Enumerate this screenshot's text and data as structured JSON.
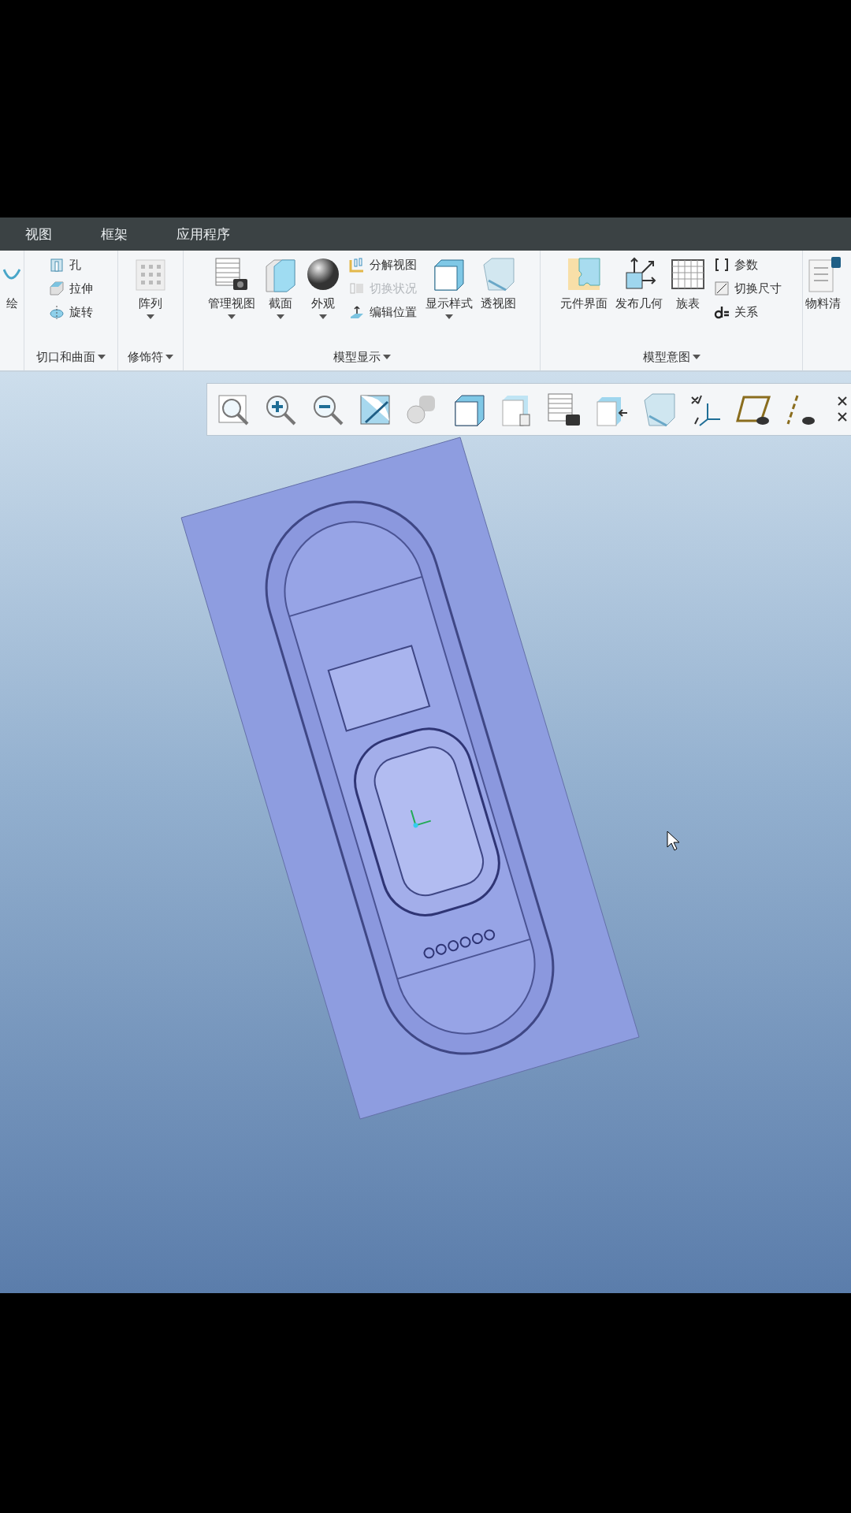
{
  "menu_tabs": [
    {
      "label": "视图"
    },
    {
      "label": "框架"
    },
    {
      "label": "应用程序"
    }
  ],
  "ribbon_groups": [
    {
      "items": [
        {
          "kind": "large",
          "label": "绘",
          "dropdown": false
        }
      ]
    },
    {
      "label": "切口和曲面",
      "items": [
        {
          "kind": "stack",
          "entries": [
            {
              "label": "孔",
              "disabled": false
            },
            {
              "label": "拉伸",
              "disabled": false
            },
            {
              "label": "旋转",
              "disabled": false
            }
          ]
        }
      ]
    },
    {
      "label": "修饰符",
      "items": [
        {
          "kind": "large",
          "label": "阵列",
          "dropdown": true
        }
      ]
    },
    {
      "label": "模型显示",
      "items": [
        {
          "kind": "large",
          "label": "管理视图",
          "dropdown": true
        },
        {
          "kind": "large",
          "label": "截面",
          "dropdown": true
        },
        {
          "kind": "large",
          "label": "外观",
          "dropdown": true
        },
        {
          "kind": "stack",
          "entries": [
            {
              "label": "分解视图",
              "disabled": false
            },
            {
              "label": "切换状况",
              "disabled": true
            },
            {
              "label": "编辑位置",
              "disabled": false
            }
          ]
        },
        {
          "kind": "large",
          "label": "显示样式",
          "dropdown": true
        },
        {
          "kind": "large",
          "label": "透视图",
          "dropdown": false
        }
      ]
    },
    {
      "label": "模型意图",
      "items": [
        {
          "kind": "large",
          "label": "元件界面",
          "dropdown": false
        },
        {
          "kind": "large",
          "label": "发布几何",
          "dropdown": false
        },
        {
          "kind": "large",
          "label": "族表",
          "dropdown": false
        },
        {
          "kind": "stack",
          "entries": [
            {
              "label": "参数",
              "disabled": false
            },
            {
              "label": "切换尺寸",
              "disabled": false
            },
            {
              "label": "关系",
              "disabled": false
            }
          ]
        }
      ]
    },
    {
      "items": [
        {
          "kind": "large",
          "label": "物料清",
          "dropdown": false
        }
      ]
    }
  ]
}
